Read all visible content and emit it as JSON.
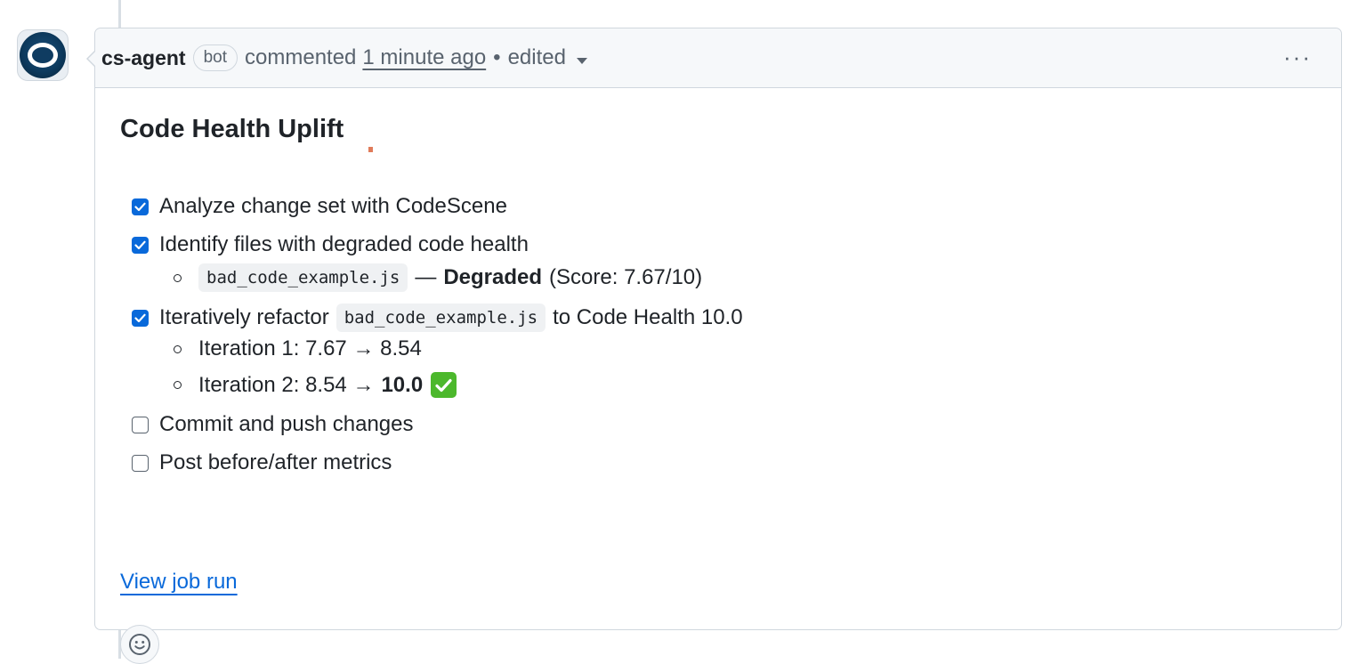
{
  "comment": {
    "author": "cs-agent",
    "badge": "bot",
    "action": "commented",
    "time": "1 minute ago",
    "separator": "•",
    "edited": "edited",
    "menu_glyph": "···"
  },
  "body": {
    "title": "Code Health Uplift",
    "tasks": [
      {
        "label": "Analyze change set with CodeScene",
        "checked": true
      },
      {
        "label": "Identify files with degraded code health",
        "checked": true,
        "sub": {
          "file": "bad_code_example.js",
          "dash": "—",
          "status": "Degraded",
          "score": "(Score: 7.67/10)"
        }
      },
      {
        "label_before": "Iteratively refactor",
        "file": "bad_code_example.js",
        "label_after": "to Code Health 10.0",
        "checked": true,
        "iterations": [
          {
            "text": "Iteration 1: 7.67 → 8.54"
          },
          {
            "text": "Iteration 2: 8.54 →",
            "final": "10.0"
          }
        ]
      },
      {
        "label": "Commit and push changes",
        "checked": false
      },
      {
        "label": "Post before/after metrics",
        "checked": false
      }
    ],
    "job_link": "View job run"
  },
  "icons": {
    "avatar": "codescene-avatar-icon",
    "checkbox_checked": "checkbox-checked-icon",
    "checkbox_unchecked": "checkbox-unchecked-icon",
    "success": "check-mark-button-icon",
    "reaction": "smiley-icon",
    "edited_dropdown": "triangle-down-icon",
    "more": "kebab-horizontal-icon"
  },
  "colors": {
    "checkbox": "#0969da",
    "link": "#0969da",
    "success_emoji": "#4cb82c"
  }
}
